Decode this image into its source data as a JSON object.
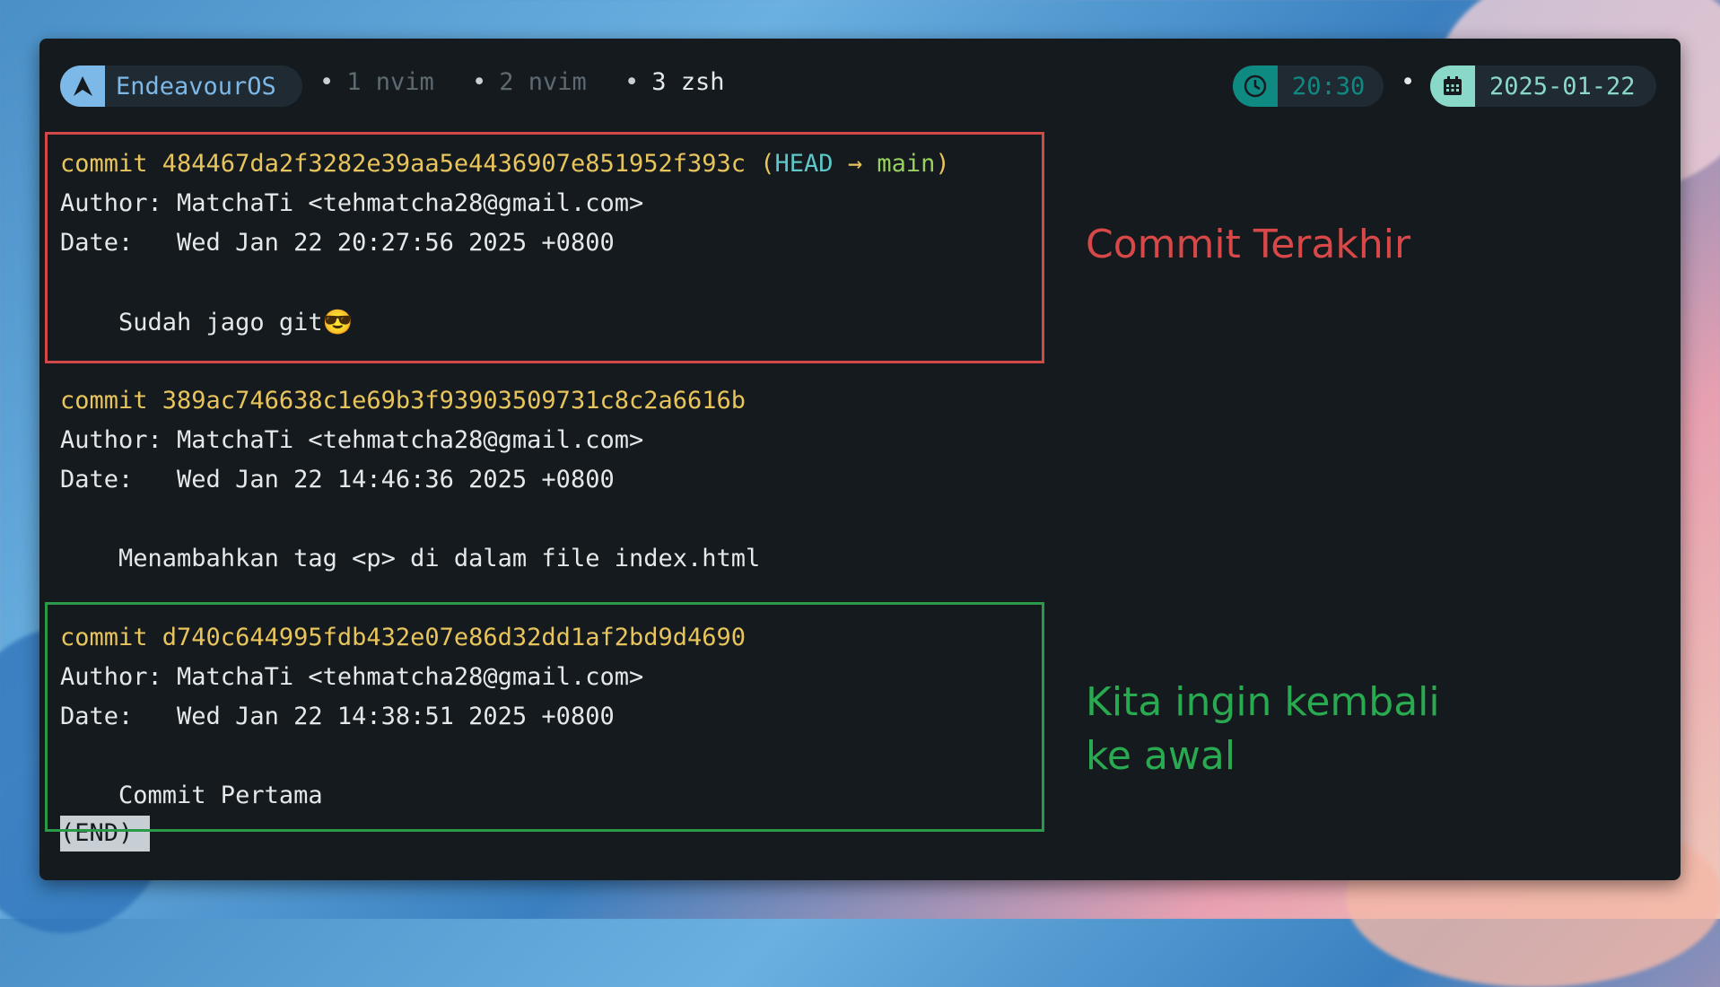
{
  "topbar": {
    "os_name": "EndeavourOS",
    "tabs": [
      {
        "label": "1 nvim",
        "active": false
      },
      {
        "label": "2 nvim",
        "active": false
      },
      {
        "label": "3 zsh",
        "active": true
      }
    ],
    "time": "20:30",
    "date": "2025-01-22"
  },
  "commits": [
    {
      "hash_line": "commit 484467da2f3282e39aa5e4436907e851952f393c",
      "ref_open": " (",
      "ref_head": "HEAD",
      "ref_arrow": " → ",
      "ref_branch": "main",
      "ref_close": ")",
      "author": "Author: MatchaTi <tehmatcha28@gmail.com>",
      "date": "Date:   Wed Jan 22 20:27:56 2025 +0800",
      "message": "    Sudah jago git😎"
    },
    {
      "hash_line": "commit 389ac746638c1e69b3f93903509731c8c2a6616b",
      "author": "Author: MatchaTi <tehmatcha28@gmail.com>",
      "date": "Date:   Wed Jan 22 14:46:36 2025 +0800",
      "message": "    Menambahkan tag <p> di dalam file index.html"
    },
    {
      "hash_line": "commit d740c644995fdb432e07e86d32dd1af2bd9d4690",
      "author": "Author: MatchaTi <tehmatcha28@gmail.com>",
      "date": "Date:   Wed Jan 22 14:38:51 2025 +0800",
      "message": "    Commit Pertama"
    }
  ],
  "pager_end": "(END)",
  "annotations": {
    "latest": "Commit Terakhir",
    "goal": "Kita ingin kembali ke awal"
  },
  "colors": {
    "hash": "#e8c45c",
    "head": "#5ec8c8",
    "branch": "#98d060",
    "latest_box": "#d04848",
    "goal_box": "#2a9a48"
  }
}
